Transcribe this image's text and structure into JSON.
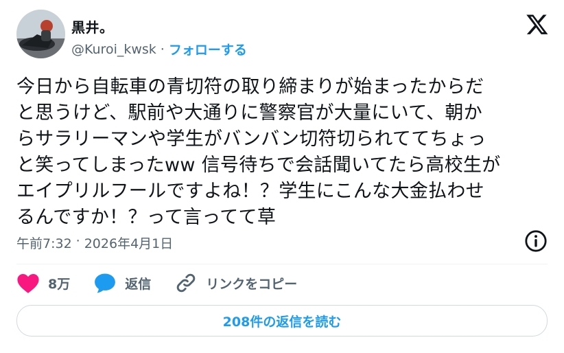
{
  "author": {
    "name": "黒井。",
    "handle": "@Kuroi_kwsk",
    "separator": "·",
    "follow_label": "フォローする"
  },
  "tweet": {
    "text": "今日から自転車の青切符の取り締まりが始まったからだ\nと思うけど、駅前や大通りに警察官が大量にいて、朝か\nらサラリーマンや学生がバンバン切符切られててちょっ\nと笑ってしまったww 信号待ちで会話聞いてたら高校生が\nエイプリルフールですよね！？学生にこんな大金払わせ\nるんですか！？って言ってて草",
    "time": "午前7:32",
    "separator": "·",
    "date": "2026年4月1日"
  },
  "actions": {
    "like_count": "8万",
    "reply_label": "返信",
    "copy_link_label": "リンクをコピー"
  },
  "read_replies_label": "208件の返信を読む",
  "colors": {
    "accent": "#1d9bf0",
    "like": "#f91880",
    "muted": "#536471",
    "text": "#0f1419"
  },
  "icons": [
    "x-logo-icon",
    "info-icon",
    "heart-icon",
    "reply-bubble-icon",
    "link-icon"
  ]
}
